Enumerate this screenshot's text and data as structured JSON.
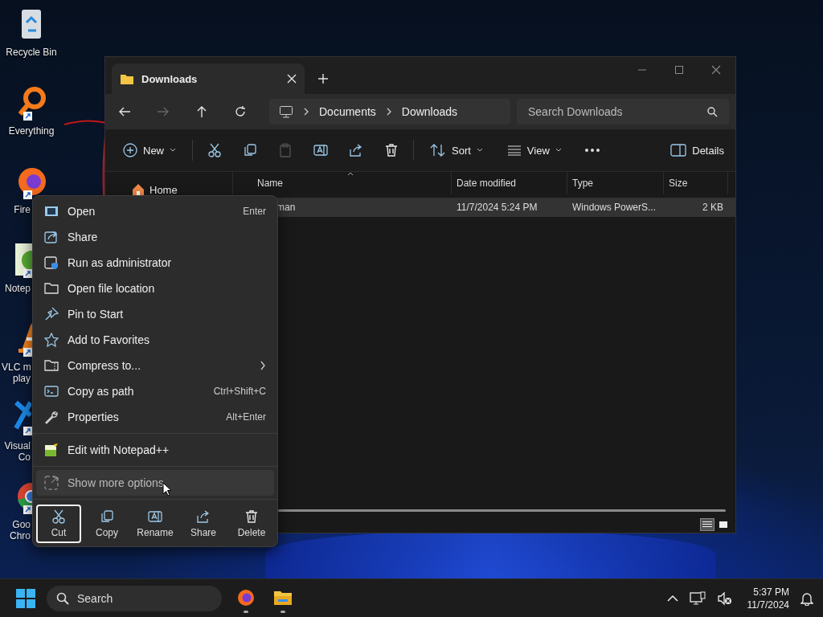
{
  "desktop_icons": [
    {
      "lines": [
        "Recycle Bin"
      ]
    },
    {
      "lines": [
        "Everything"
      ]
    },
    {
      "lines": [
        "Fire"
      ]
    },
    {
      "lines": [
        "Notep"
      ]
    },
    {
      "lines": [
        "VLC m",
        "play"
      ]
    },
    {
      "lines": [
        "Visual",
        "Co"
      ]
    },
    {
      "lines": [
        "Goo",
        "Chro"
      ]
    }
  ],
  "explorer": {
    "tab": {
      "title": "Downloads"
    },
    "breadcrumb": [
      "Documents",
      "Downloads"
    ],
    "search": {
      "placeholder": "Search Downloads"
    },
    "command_bar": {
      "new": "New",
      "sort": "Sort",
      "view": "View",
      "details": "Details"
    },
    "nav_pane": [
      {
        "label": "Home"
      }
    ],
    "columns": [
      "Name",
      "Date modified",
      "Type",
      "Size"
    ],
    "rows": [
      {
        "cells": [
          "man",
          "11/7/2024 5:24 PM",
          "Windows PowerS...",
          "2 KB"
        ],
        "selected": true
      }
    ],
    "view_buttons": [
      {
        "selected": true
      },
      {
        "selected": false
      }
    ]
  },
  "context_menu": {
    "groups": [
      [
        {
          "label": "Open",
          "shortcut": "Enter",
          "submenu": false,
          "highlighted": false
        },
        {
          "label": "Share",
          "submenu": false,
          "highlighted": false
        },
        {
          "label": "Run as administrator",
          "submenu": false,
          "highlighted": false
        },
        {
          "label": "Open file location",
          "submenu": false,
          "highlighted": false
        },
        {
          "label": "Pin to Start",
          "submenu": false,
          "highlighted": false
        },
        {
          "label": "Add to Favorites",
          "submenu": false,
          "highlighted": false
        },
        {
          "label": "Compress to...",
          "submenu": true,
          "highlighted": false
        },
        {
          "label": "Copy as path",
          "shortcut": "Ctrl+Shift+C",
          "submenu": false,
          "highlighted": false
        },
        {
          "label": "Properties",
          "shortcut": "Alt+Enter",
          "submenu": false,
          "highlighted": false
        }
      ],
      [
        {
          "label": "Edit with Notepad++",
          "submenu": false,
          "highlighted": false
        }
      ],
      [
        {
          "label": "Show more options",
          "submenu": false,
          "highlighted": true
        }
      ]
    ],
    "actions": [
      {
        "label": "Cut",
        "focused": true
      },
      {
        "label": "Copy",
        "focused": false
      },
      {
        "label": "Rename",
        "focused": false
      },
      {
        "label": "Share",
        "focused": false
      },
      {
        "label": "Delete",
        "focused": false
      }
    ]
  },
  "taskbar": {
    "search": {
      "placeholder": "Search"
    },
    "apps": [
      {
        "running": true
      },
      {
        "running": true
      }
    ],
    "time": "5:37 PM",
    "date": "11/7/2024"
  }
}
